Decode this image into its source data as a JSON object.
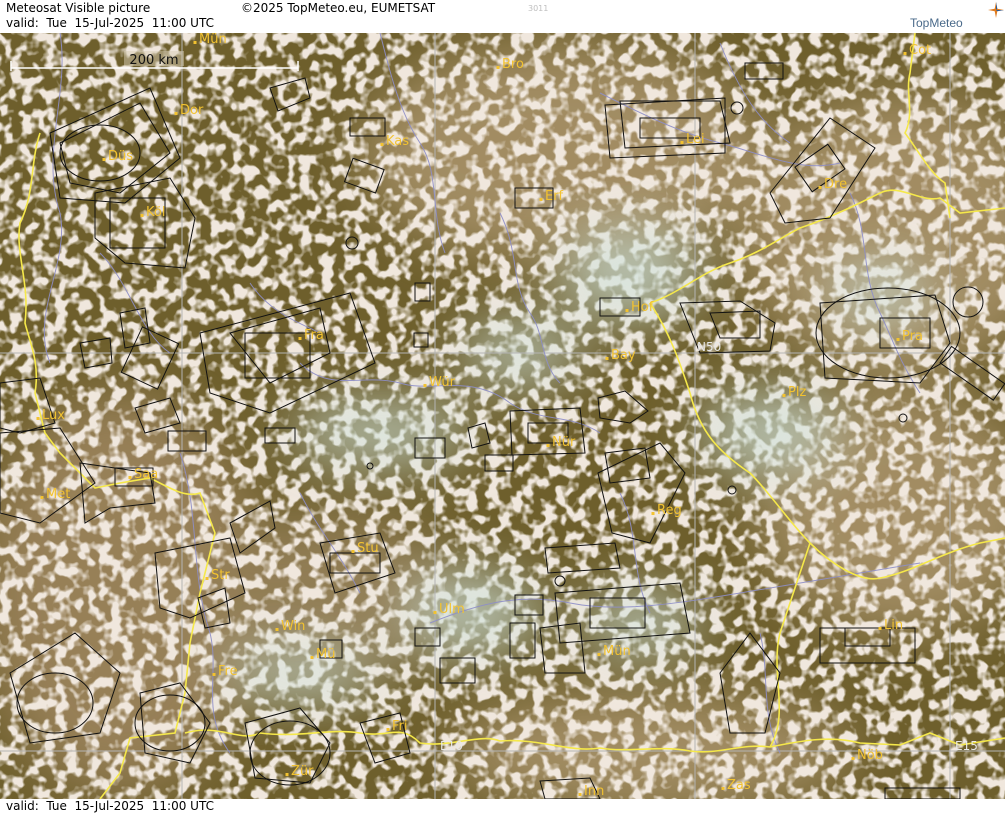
{
  "header": {
    "title": "Meteosat Visible picture",
    "copyright": "©2025 TopMeteo.eu, EUMETSAT",
    "image_id": "3011",
    "valid": "valid:  Tue  15-Jul-2025  11:00 UTC",
    "logo_text": "TopMeteo"
  },
  "footer": {
    "valid": "valid:  Tue  15-Jul-2025  11:00 UTC"
  },
  "scale_bar": {
    "label": "200 km"
  },
  "grid_labels": [
    "N50",
    "E10",
    "E15"
  ],
  "cities": [
    "Mün",
    "Bro",
    "Cot",
    "Dor",
    "Kas",
    "Lei",
    "Düs",
    "Erf",
    "Dre",
    "Köl",
    "Hof",
    "Fra",
    "Pra",
    "Bay",
    "Wür",
    "Plz",
    "Lux",
    "Nür",
    "Saa",
    "Met",
    "Reg",
    "Stu",
    "Str",
    "Ulm",
    "Win",
    "Mü",
    "Mün",
    "Lin",
    "Fre",
    "Fri",
    "Zür",
    "Inn",
    "Zas",
    "Nöb"
  ],
  "colors": {
    "border": "#f5e84a",
    "river": "#8e8ec8",
    "airspace": "#111111",
    "city_label": "#f2c230",
    "grid": "#b4b4b4",
    "land_dark": "#6e5f2c",
    "cloud": "#dcccb6",
    "high_cloud": "#c8dcd6"
  }
}
